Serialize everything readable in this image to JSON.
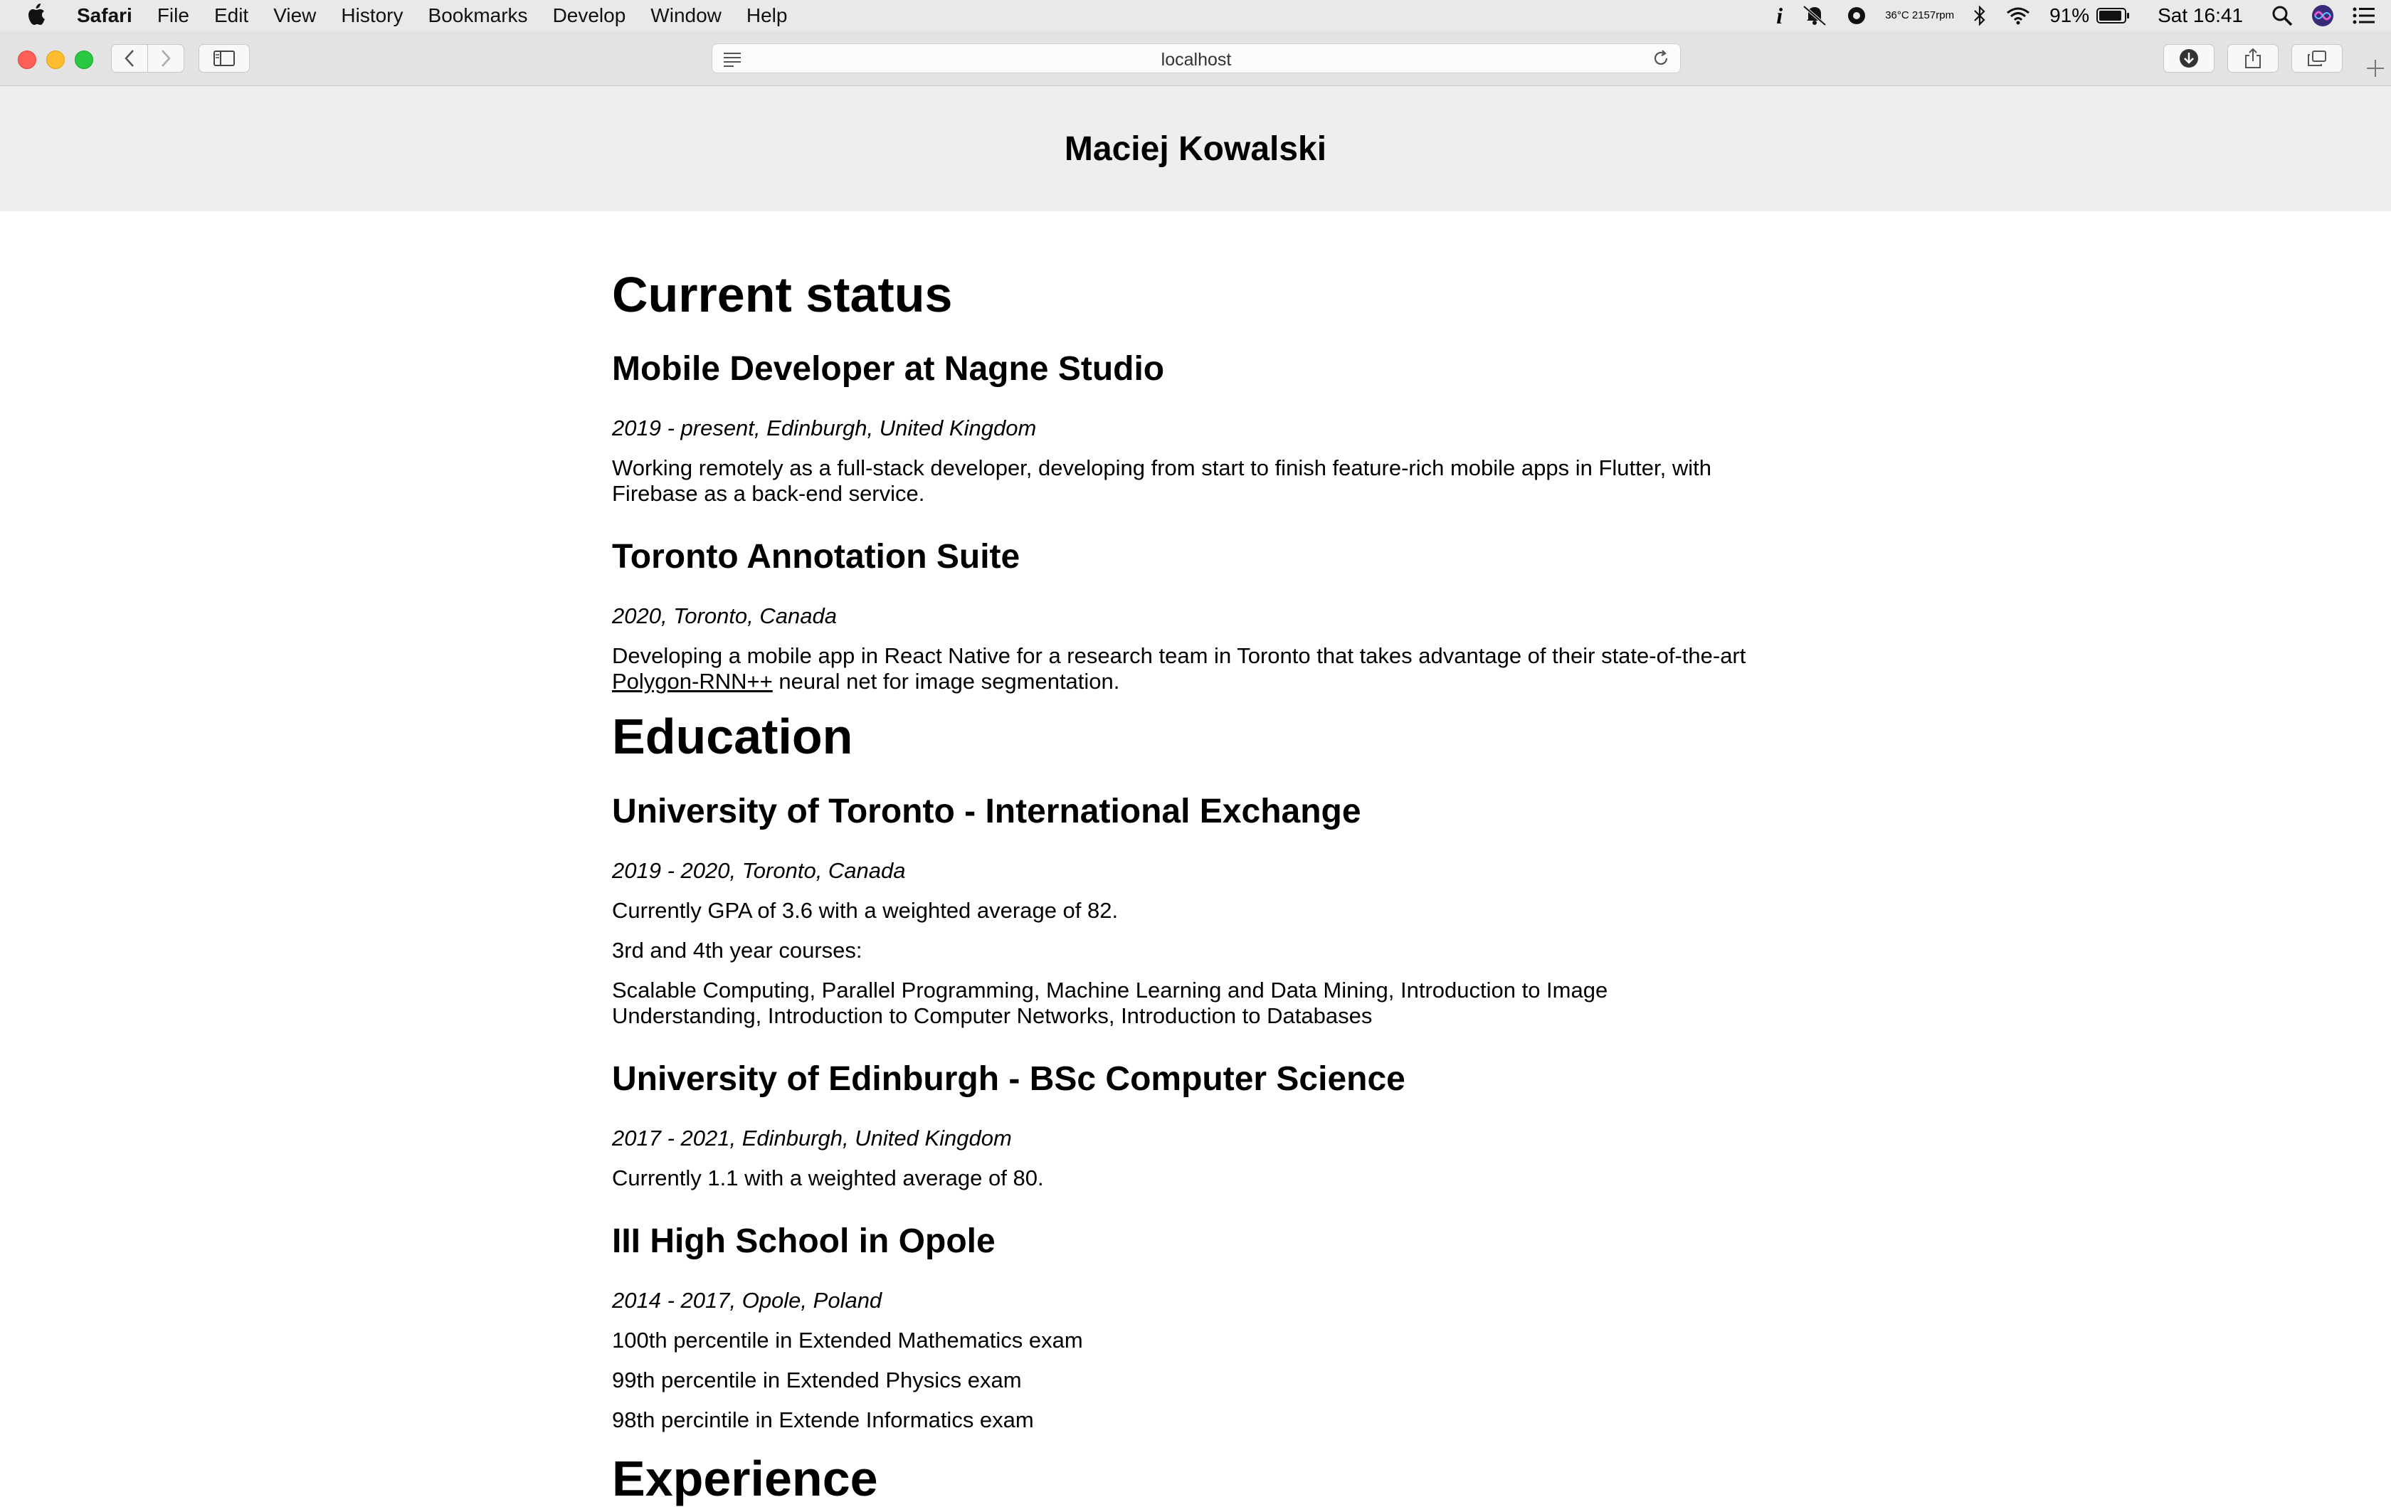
{
  "menubar": {
    "app": "Safari",
    "items": [
      "File",
      "Edit",
      "View",
      "History",
      "Bookmarks",
      "Develop",
      "Window",
      "Help"
    ],
    "status": {
      "temp": "36°C",
      "fan": "2157rpm",
      "battery": "91%",
      "clock": "Sat 16:41"
    }
  },
  "browser": {
    "url": "localhost"
  },
  "page": {
    "name": "Maciej Kowalski",
    "sections": {
      "current": {
        "heading": "Current status",
        "job1": {
          "title": "Mobile Developer at Nagne Studio",
          "meta": "2019 - present, Edinburgh, United Kingdom",
          "desc": "Working remotely as a full-stack developer, developing from start to finish feature-rich mobile apps in Flutter, with Firebase as a back-end service."
        },
        "job2": {
          "title": "Toronto Annotation Suite",
          "meta": "2020, Toronto, Canada",
          "desc_before": "Developing a mobile app in React Native for a research team in Toronto that takes advantage of their state-of-the-art ",
          "link": "Polygon-RNN++",
          "desc_after": " neural net for image segmentation."
        }
      },
      "education": {
        "heading": "Education",
        "toronto": {
          "title": "University of Toronto - International Exchange",
          "meta": "2019 - 2020, Toronto, Canada",
          "gpa": "Currently GPA of 3.6 with a weighted average of 82.",
          "courses_label": "3rd and 4th year courses:",
          "courses": "Scalable Computing, Parallel Programming, Machine Learning and Data Mining, Introduction to Image Understanding, Introduction to Computer Networks, Introduction to Databases"
        },
        "edinburgh": {
          "title": "University of Edinburgh - BSc Computer Science",
          "meta": "2017 - 2021, Edinburgh, United Kingdom",
          "grade": "Currently 1.1 with a weighted average of 80."
        },
        "highschool": {
          "title": "III High School in Opole",
          "meta": "2014 - 2017, Opole, Poland",
          "results": [
            "100th percentile in Extended Mathematics exam",
            "99th percentile in Extended Physics exam",
            "98th percintile in Extende Informatics exam"
          ]
        }
      },
      "experience": {
        "heading": "Experience"
      }
    }
  }
}
